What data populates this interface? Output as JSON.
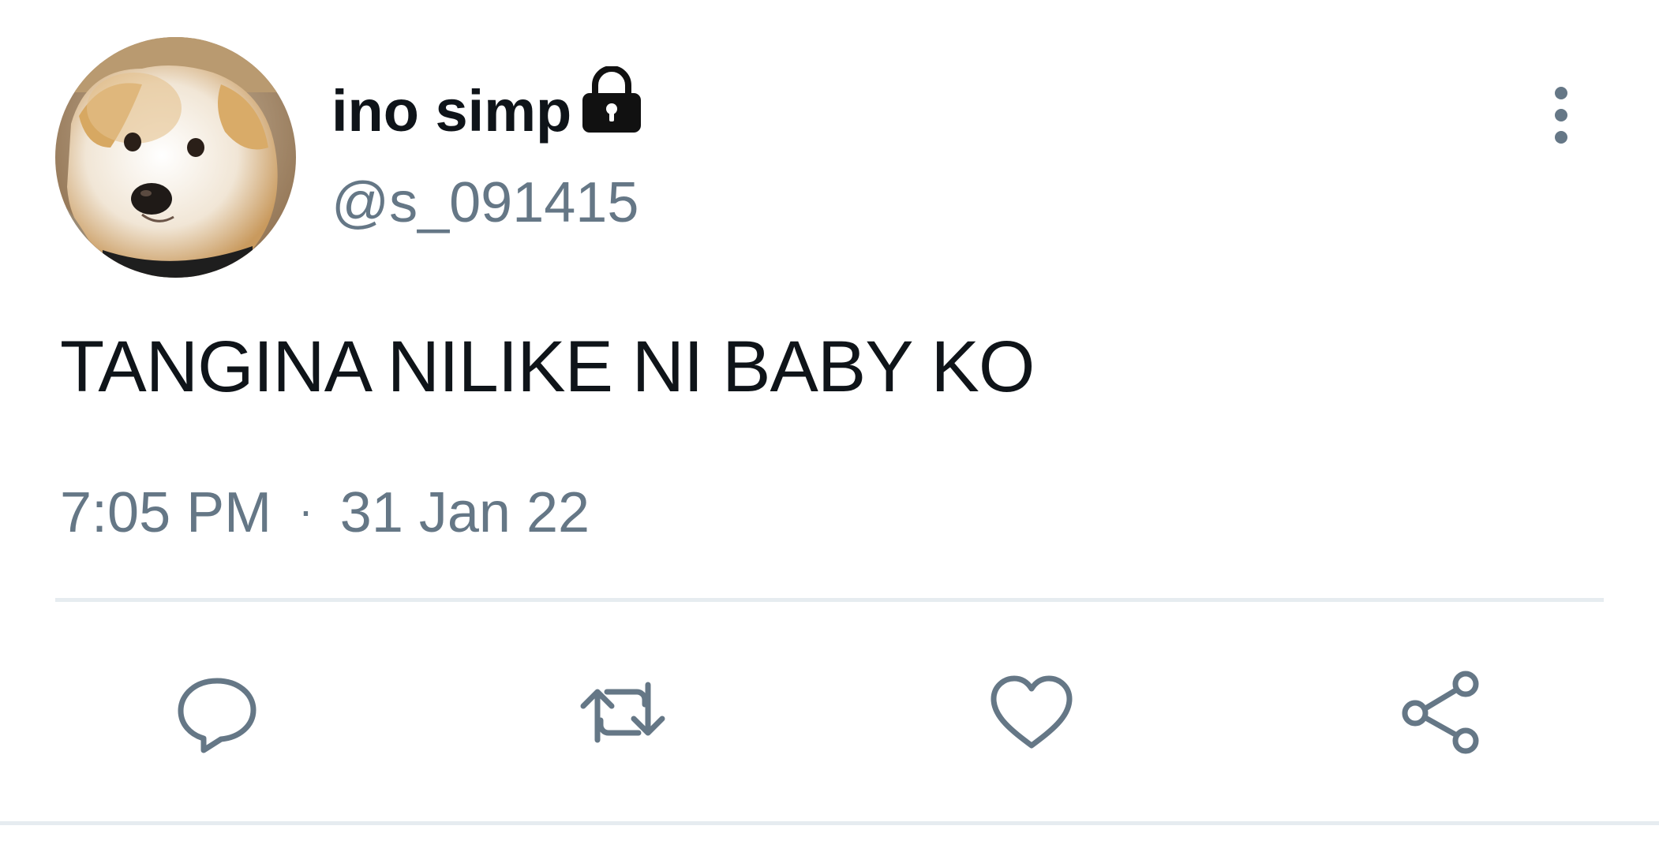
{
  "user": {
    "display_name": "ino simp",
    "handle": "@s_091415",
    "protected_icon": "lock-icon",
    "avatar_icon": "dog-avatar"
  },
  "tweet": {
    "text": "TANGINA NILIKE NI BABY KO",
    "time": "7:05 PM",
    "separator": "·",
    "date": "31 Jan 22"
  },
  "actions": {
    "reply_icon": "reply-icon",
    "retweet_icon": "retweet-icon",
    "like_icon": "heart-icon",
    "share_icon": "share-icon",
    "more_icon": "more-vertical-icon"
  },
  "colors": {
    "text_primary": "#0f1419",
    "text_secondary": "#657786",
    "divider": "#e6ecf0"
  }
}
